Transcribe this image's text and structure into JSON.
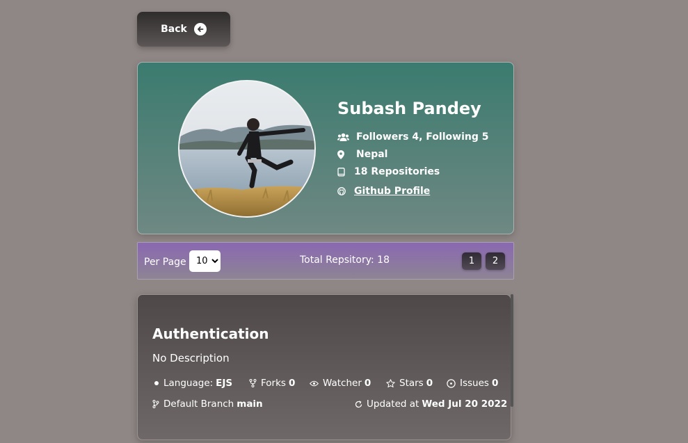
{
  "back_button": {
    "label": "Back",
    "icon": "arrow-left-circle-icon"
  },
  "profile": {
    "name": "Subash Pandey",
    "follow_text": "Followers 4, Following 5",
    "location": "Nepal",
    "repositories": "18 Repositories",
    "github_link": "Github Profile",
    "avatar": "profile-photo"
  },
  "pagination": {
    "per_page_label": "Per Page",
    "per_page_value": "10",
    "per_page_options": [
      "10"
    ],
    "total_text": "Total Repsitory: 18",
    "pages": [
      "1",
      "2"
    ]
  },
  "repo": {
    "title": "Authentication",
    "description": "No Description",
    "language_label": "Language:",
    "language": "EJS",
    "forks_label": "Forks",
    "forks": "0",
    "watcher_label": "Watcher",
    "watcher": "0",
    "stars_label": "Stars",
    "stars": "0",
    "issues_label": "Issues",
    "issues": "0",
    "branch_label": "Default Branch",
    "branch": "main",
    "updated_label": "Updated at",
    "updated": "Wed Jul 20 2022"
  },
  "colors": {
    "background": "#8f8785",
    "profile_gradient_top": "#3b7b6f",
    "pager_gradient_top": "#8a68b2",
    "repo_card_top": "#4e4848"
  }
}
